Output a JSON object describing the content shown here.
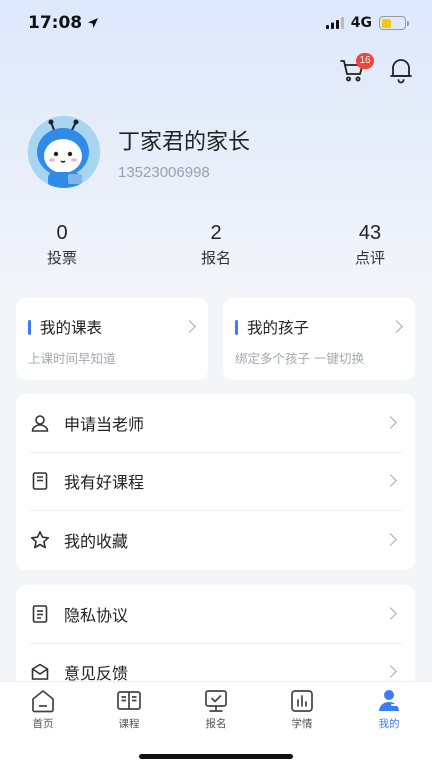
{
  "status_bar": {
    "time": "17:08",
    "network": "4G"
  },
  "header": {
    "cart_badge": "16"
  },
  "profile": {
    "name": "丁家君的家长",
    "phone": "13523006998"
  },
  "stats": [
    {
      "value": "0",
      "label": "投票"
    },
    {
      "value": "2",
      "label": "报名"
    },
    {
      "value": "43",
      "label": "点评"
    }
  ],
  "quick_cards": [
    {
      "title": "我的课表",
      "subtitle": "上课时间早知道"
    },
    {
      "title": "我的孩子",
      "subtitle": "绑定多个孩子 一键切换"
    }
  ],
  "menu_group_1": [
    {
      "label": "申请当老师",
      "icon": "user-icon"
    },
    {
      "label": "我有好课程",
      "icon": "book-icon"
    },
    {
      "label": "我的收藏",
      "icon": "star-icon"
    }
  ],
  "menu_group_2": [
    {
      "label": "隐私协议",
      "icon": "document-icon"
    },
    {
      "label": "意见反馈",
      "icon": "feedback-icon"
    }
  ],
  "tabbar": [
    {
      "label": "首页",
      "icon": "home-icon"
    },
    {
      "label": "课程",
      "icon": "open-book-icon"
    },
    {
      "label": "报名",
      "icon": "monitor-check-icon"
    },
    {
      "label": "学情",
      "icon": "bar-chart-icon"
    },
    {
      "label": "我的",
      "icon": "profile-icon",
      "active": true
    }
  ],
  "colors": {
    "accent": "#3b7cf6",
    "badge": "#f0453a",
    "battery": "#f5c518"
  }
}
